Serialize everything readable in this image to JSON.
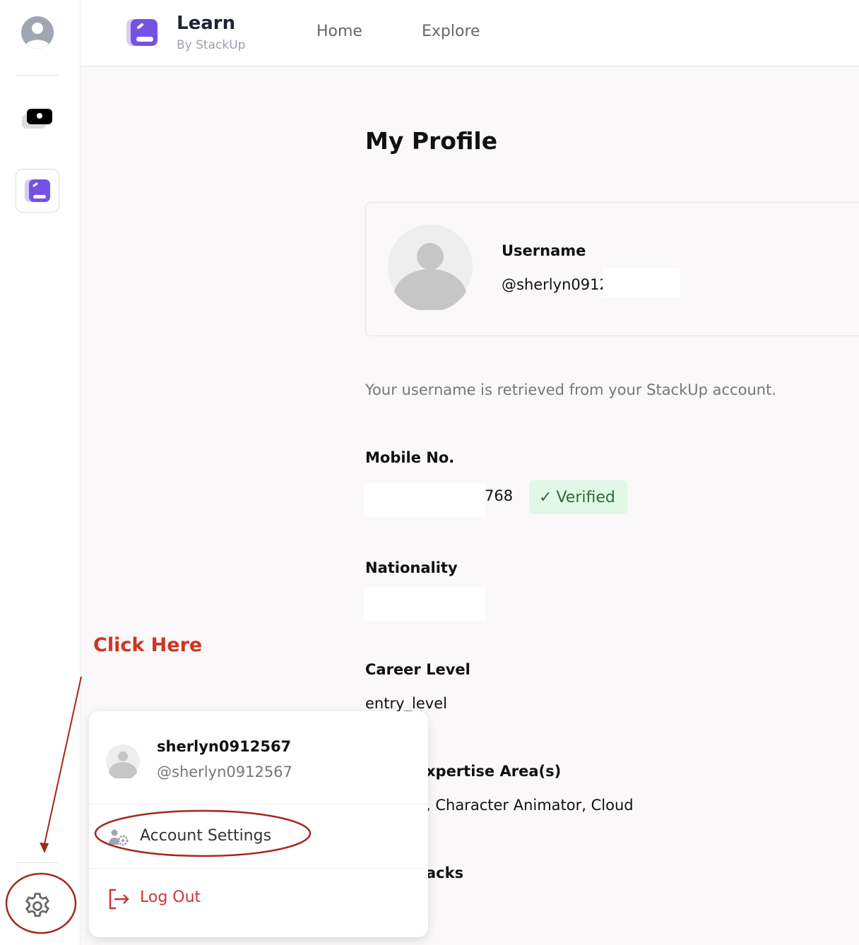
{
  "app": {
    "title": "Learn",
    "subtitle": "By StackUp",
    "brand_color": "#7552e6"
  },
  "nav": {
    "items": [
      "Home",
      "Explore"
    ]
  },
  "sidebar": {
    "icons": [
      "user-avatar-icon",
      "toggle-icon",
      "learn-app-icon",
      "settings-icon"
    ]
  },
  "profile": {
    "title": "My Profile",
    "username_label": "Username",
    "username": "@sherlyn0912",
    "note": "Your username is retrieved from your StackUp account.",
    "mobile_label": "Mobile No.",
    "mobile": "768",
    "verified": "Verified",
    "nationality_label": "Nationality",
    "career_label": "Career Level",
    "career": "entry_level",
    "expertise_label": "xpertise Area(s)",
    "expertise": ", Character Animator, Cloud",
    "tracks_label": "acks"
  },
  "menu": {
    "name": "sherlyn0912567",
    "handle": "@sherlyn0912567",
    "account_settings": "Account Settings",
    "logout": "Log Out",
    "logout_color": "#c9373a"
  },
  "annotation": {
    "text": "Click Here",
    "color": "#d0341f"
  }
}
